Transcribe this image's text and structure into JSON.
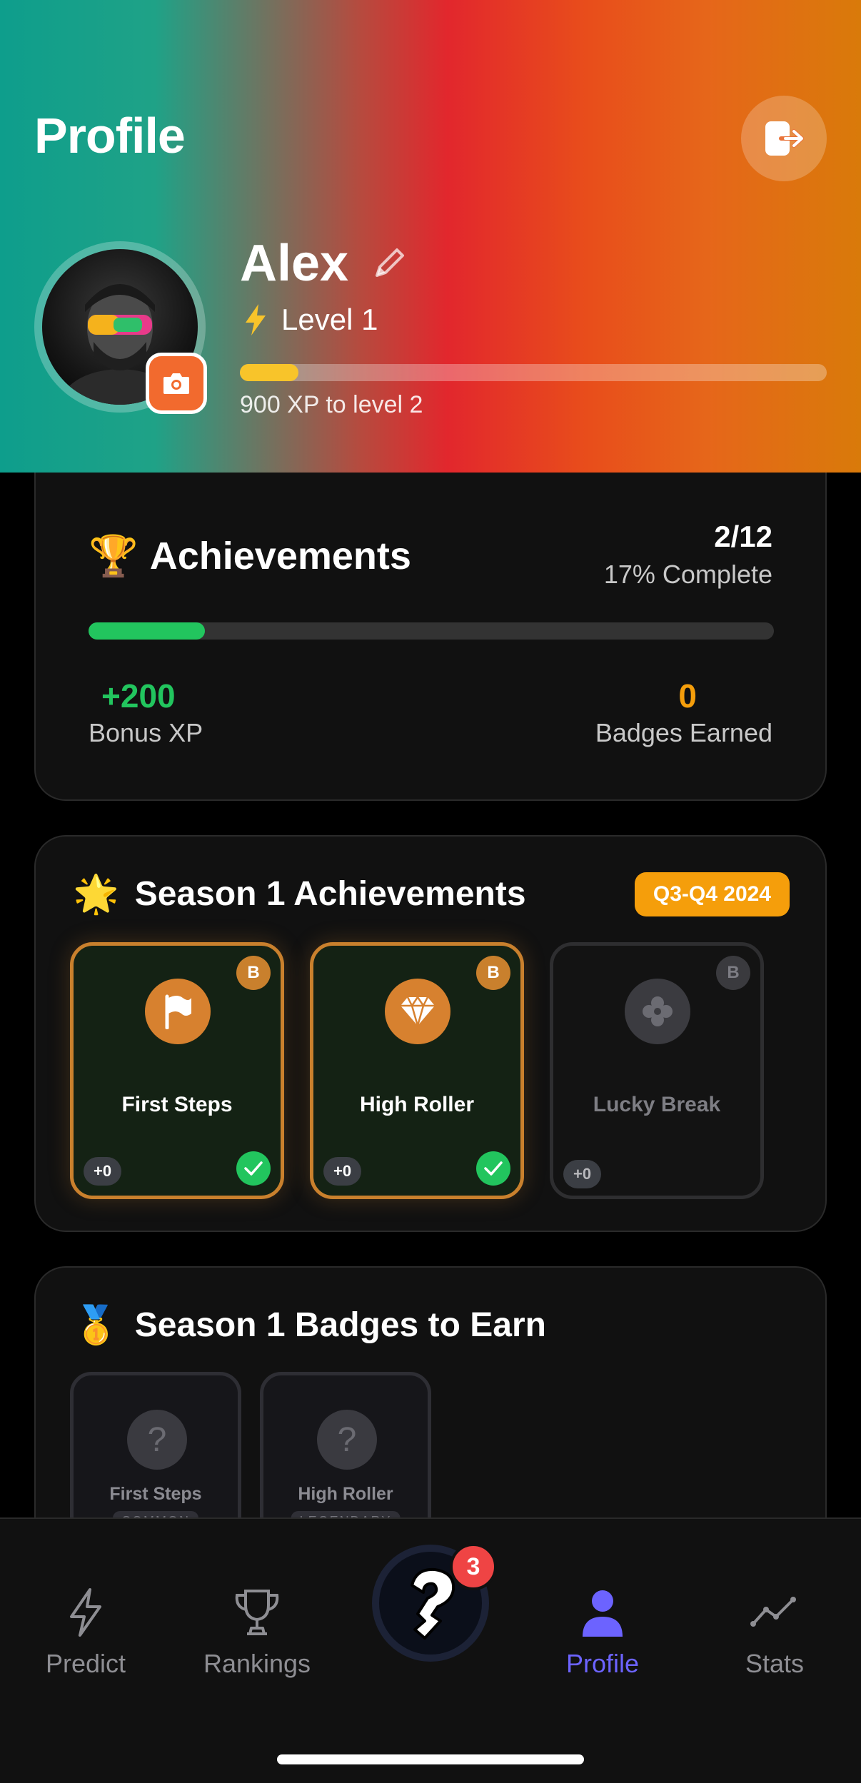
{
  "header": {
    "title": "Profile",
    "user_name": "Alex",
    "level_text": "Level 1",
    "xp_progress": 0.1,
    "xp_to_next": "900 XP to level 2"
  },
  "achievements": {
    "title": "Achievements",
    "emoji": "🏆",
    "count": "2/12",
    "complete_text": "17% Complete",
    "progress": 0.17,
    "bonus_xp_value": "+200",
    "bonus_xp_label": "Bonus XP",
    "badges_earned_value": "0",
    "badges_earned_label": "Badges Earned"
  },
  "season_achievements": {
    "title": "Season 1 Achievements",
    "emoji": "🌟",
    "season_pill": "Q3-Q4 2024",
    "tiles": [
      {
        "name": "First Steps",
        "badge": "B",
        "xp": "+0",
        "icon": "flag-icon",
        "earned": true
      },
      {
        "name": "High Roller",
        "badge": "B",
        "xp": "+0",
        "icon": "diamond-icon",
        "earned": true
      },
      {
        "name": "Lucky Break",
        "badge": "B",
        "xp": "+0",
        "icon": "clover-icon",
        "earned": false
      }
    ]
  },
  "season_badges": {
    "title": "Season 1 Badges to Earn",
    "emoji": "🥇",
    "tiles": [
      {
        "name": "First Steps",
        "rarity": "COMMON",
        "icon": "question-icon"
      },
      {
        "name": "High Roller",
        "rarity": "LEGENDARY",
        "icon": "question-icon"
      }
    ]
  },
  "nav": {
    "items": [
      {
        "label": "Predict",
        "icon": "lightning-icon"
      },
      {
        "label": "Rankings",
        "icon": "trophy-icon"
      },
      {
        "label": "Profile",
        "icon": "person-icon",
        "active": true
      },
      {
        "label": "Stats",
        "icon": "chart-line-icon"
      }
    ],
    "center_badge": "3"
  },
  "colors": {
    "accent_green": "#22c55e",
    "accent_orange": "#f59e0b",
    "nav_active": "#6c63ff",
    "xp_fill": "#f8c42a"
  }
}
